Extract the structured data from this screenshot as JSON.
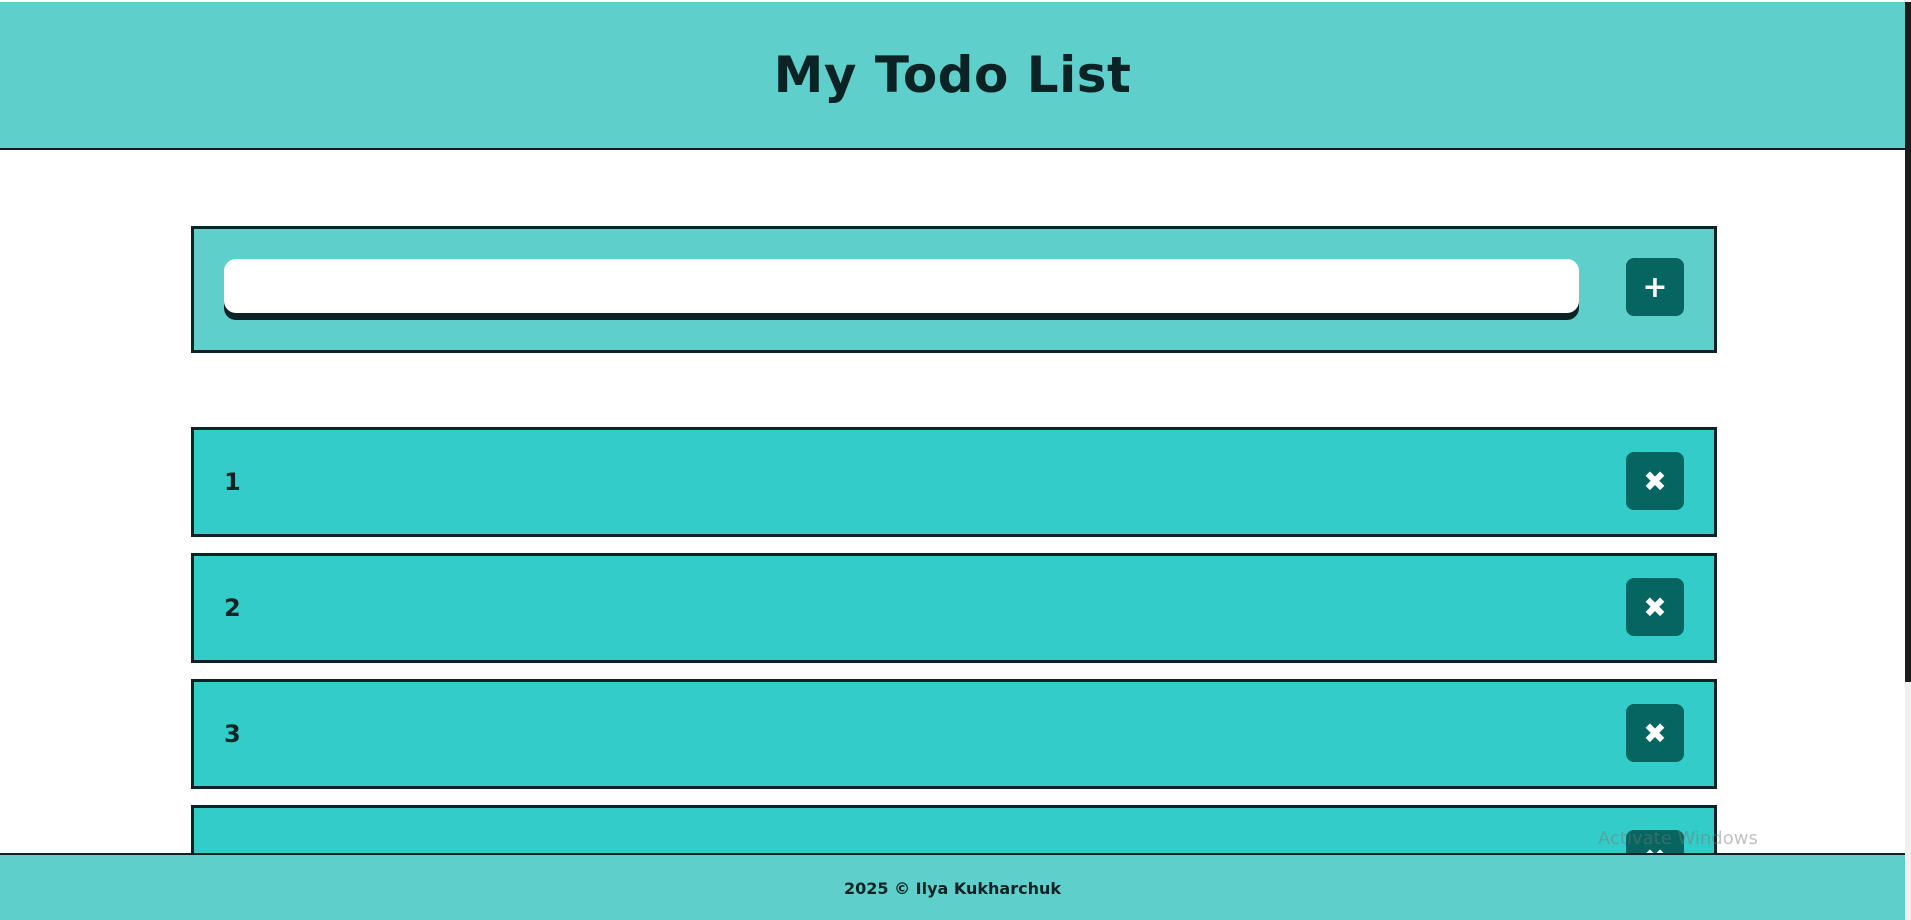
{
  "header": {
    "title": "My Todo List"
  },
  "add_form": {
    "input_value": "",
    "input_placeholder": "",
    "add_button_label": "+"
  },
  "todos": [
    {
      "text": "1",
      "delete_label": "✖"
    },
    {
      "text": "2",
      "delete_label": "✖"
    },
    {
      "text": "3",
      "delete_label": "✖"
    },
    {
      "text": "",
      "delete_label": "✖"
    }
  ],
  "footer": {
    "text": "2025 © Ilya Kukharchuk"
  },
  "os_overlay": {
    "watermark": "Activate Windows"
  },
  "colors": {
    "header_bg": "#5fcfcb",
    "item_bg": "#32cdc8",
    "button_bg": "#066461",
    "border": "#0b2325"
  },
  "icons": {
    "add": "plus-icon",
    "delete": "close-icon"
  }
}
